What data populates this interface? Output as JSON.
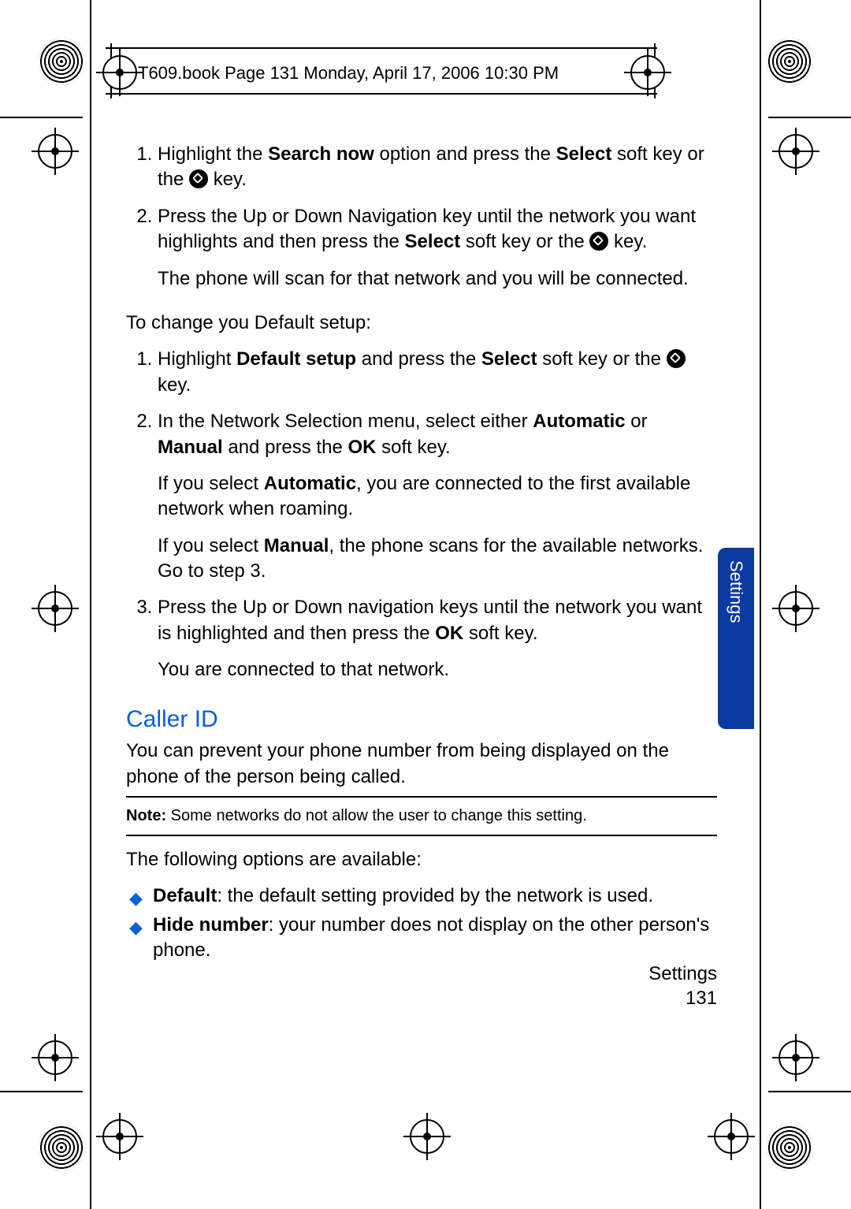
{
  "header_slug": "T609.book  Page 131  Monday, April 17, 2006  10:30 PM",
  "steps_a": {
    "s1_pre": "Highlight the ",
    "s1_b1": "Search now",
    "s1_mid": " option and press the ",
    "s1_b2": "Select",
    "s1_post": " soft key or the ",
    "s1_tail": " key.",
    "s2_pre": "Press the Up or Down Navigation key until the network you want highlights and then press the ",
    "s2_b1": "Select",
    "s2_mid": " soft key or the ",
    "s2_tail": " key.",
    "s2_follow": "The phone will scan for that network and you will be connected."
  },
  "change_default_intro": "To change you Default setup:",
  "steps_b": {
    "s1_pre": "Highlight ",
    "s1_b1": "Default setup",
    "s1_mid": " and press the ",
    "s1_b2": "Select",
    "s1_post": " soft key or the ",
    "s1_tail": " key.",
    "s2_pre": "In the Network Selection menu, select either ",
    "s2_b1": "Automatic",
    "s2_mid": " or ",
    "s2_b2": "Manual",
    "s2_post": " and press the ",
    "s2_b3": "OK",
    "s2_tail": " soft key.",
    "s2_follow1_pre": "If you select ",
    "s2_follow1_b": "Automatic",
    "s2_follow1_post": ", you are connected to the first available network when roaming.",
    "s2_follow2_pre": "If you select ",
    "s2_follow2_b": "Manual",
    "s2_follow2_post": ", the phone scans for the available networks. Go to step 3.",
    "s3_pre": "Press the Up or Down navigation keys until the network you want is highlighted and then press the ",
    "s3_b1": "OK",
    "s3_tail": " soft key.",
    "s3_follow": "You are connected to that network."
  },
  "section_title": "Caller ID",
  "caller_id_intro": "You can prevent your phone number from being displayed on the phone of the person being called.",
  "note_lead": "Note: ",
  "note_body": "Some networks do not allow the user to change this setting.",
  "options_intro": "The following options are available:",
  "options": {
    "o1_b": "Default",
    "o1_post": ": the default setting provided by the network is used.",
    "o2_b": "Hide number",
    "o2_post": ": your number does not display on the other person's phone."
  },
  "thumb_tab": "Settings",
  "footer_section": "Settings",
  "footer_page": "131"
}
